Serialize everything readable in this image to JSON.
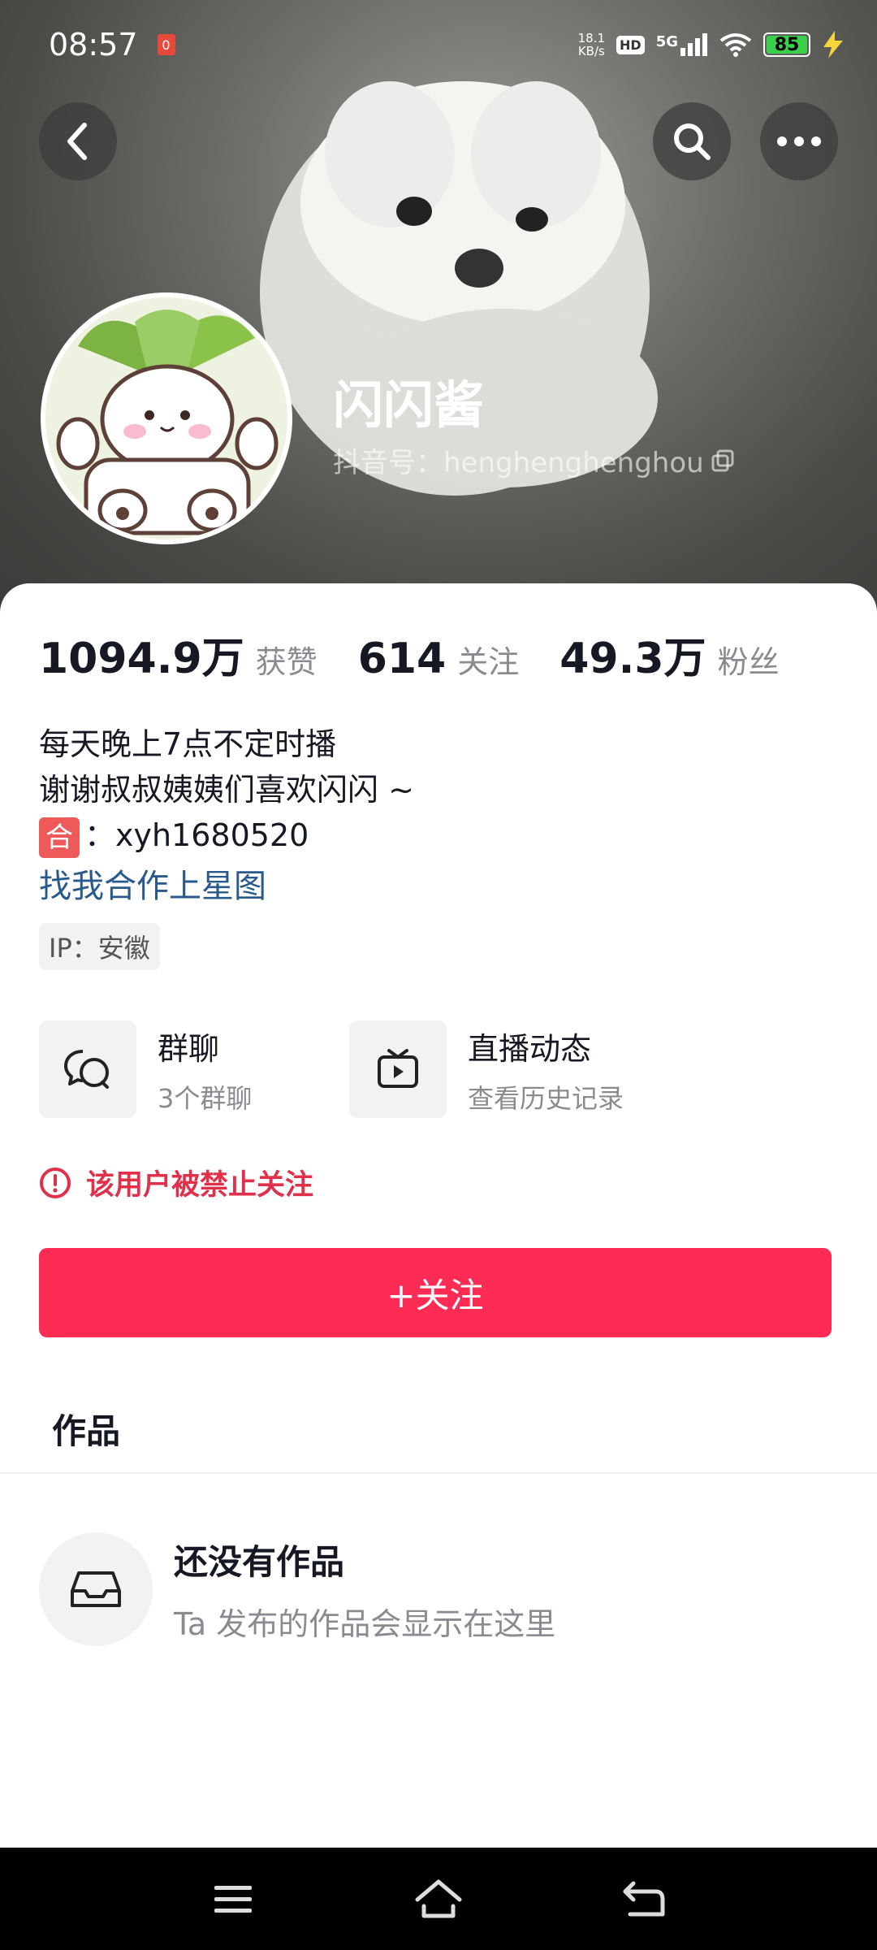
{
  "status_bar": {
    "time": "08:57",
    "notification_badge": "0",
    "net_speed_value": "18.1",
    "net_speed_unit": "KB/s",
    "hd_label": "HD",
    "network": "5G",
    "battery": "85"
  },
  "profile": {
    "nickname": "闪闪酱",
    "douyin_id": "抖音号：henghenghenghou"
  },
  "stats": [
    {
      "value": "1094.9万",
      "label": "获赞"
    },
    {
      "value": "614",
      "label": "关注"
    },
    {
      "value": "49.3万",
      "label": "粉丝"
    }
  ],
  "bio": {
    "line1": "每天晚上7点不定时播",
    "line2": "谢谢叔叔姨姨们喜欢闪闪 ~",
    "line3_badge": "合",
    "line3_text": "：xyh1680520",
    "link": "找我合作上星图",
    "ip": "IP：安徽"
  },
  "features": {
    "group_chat": {
      "title": "群聊",
      "subtitle": "3个群聊"
    },
    "live": {
      "title": "直播动态",
      "subtitle": "查看历史记录"
    }
  },
  "warning": "该用户被禁止关注",
  "follow_button": "+关注",
  "tabs": {
    "works": "作品"
  },
  "empty_state": {
    "title": "还没有作品",
    "subtitle": "Ta 发布的作品会显示在这里"
  },
  "colors": {
    "accent": "#fe2c55",
    "warning": "#e0304a",
    "link": "#2a5a8c"
  }
}
